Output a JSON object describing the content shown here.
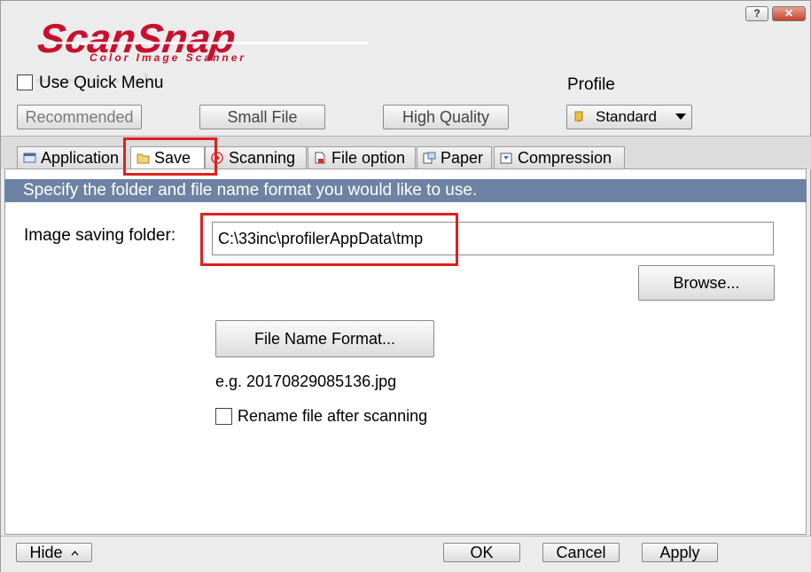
{
  "titlebar": {
    "help_label": "?",
    "close_label": "✕"
  },
  "logo": {
    "brand": "ScanSnap",
    "tagline": "Color Image Scanner"
  },
  "quick_menu": {
    "label": "Use Quick Menu",
    "checked": false
  },
  "profile": {
    "label": "Profile",
    "presets": [
      "Recommended",
      "Small File",
      "High Quality"
    ],
    "selected": "Standard"
  },
  "tabs": [
    {
      "label": "Application",
      "icon": "application-icon"
    },
    {
      "label": "Save",
      "icon": "folder-icon",
      "active": true
    },
    {
      "label": "Scanning",
      "icon": "scanning-icon"
    },
    {
      "label": "File option",
      "icon": "file-option-icon"
    },
    {
      "label": "Paper",
      "icon": "paper-icon"
    },
    {
      "label": "Compression",
      "icon": "compression-icon"
    }
  ],
  "save_tab": {
    "banner": "Specify the folder and file name format you would like to use.",
    "folder_label": "Image saving folder:",
    "folder_value": "C:\\33inc\\profilerAppData\\tmp",
    "browse_label": "Browse...",
    "file_name_format_label": "File Name Format...",
    "example": "e.g. 20170829085136.jpg",
    "rename_label": "Rename file after scanning",
    "rename_checked": false
  },
  "footer": {
    "hide_label": "Hide",
    "ok_label": "OK",
    "cancel_label": "Cancel",
    "apply_label": "Apply"
  },
  "colors": {
    "highlight": "#e02020",
    "brand": "#c8102e",
    "banner": "#6e83a3"
  }
}
